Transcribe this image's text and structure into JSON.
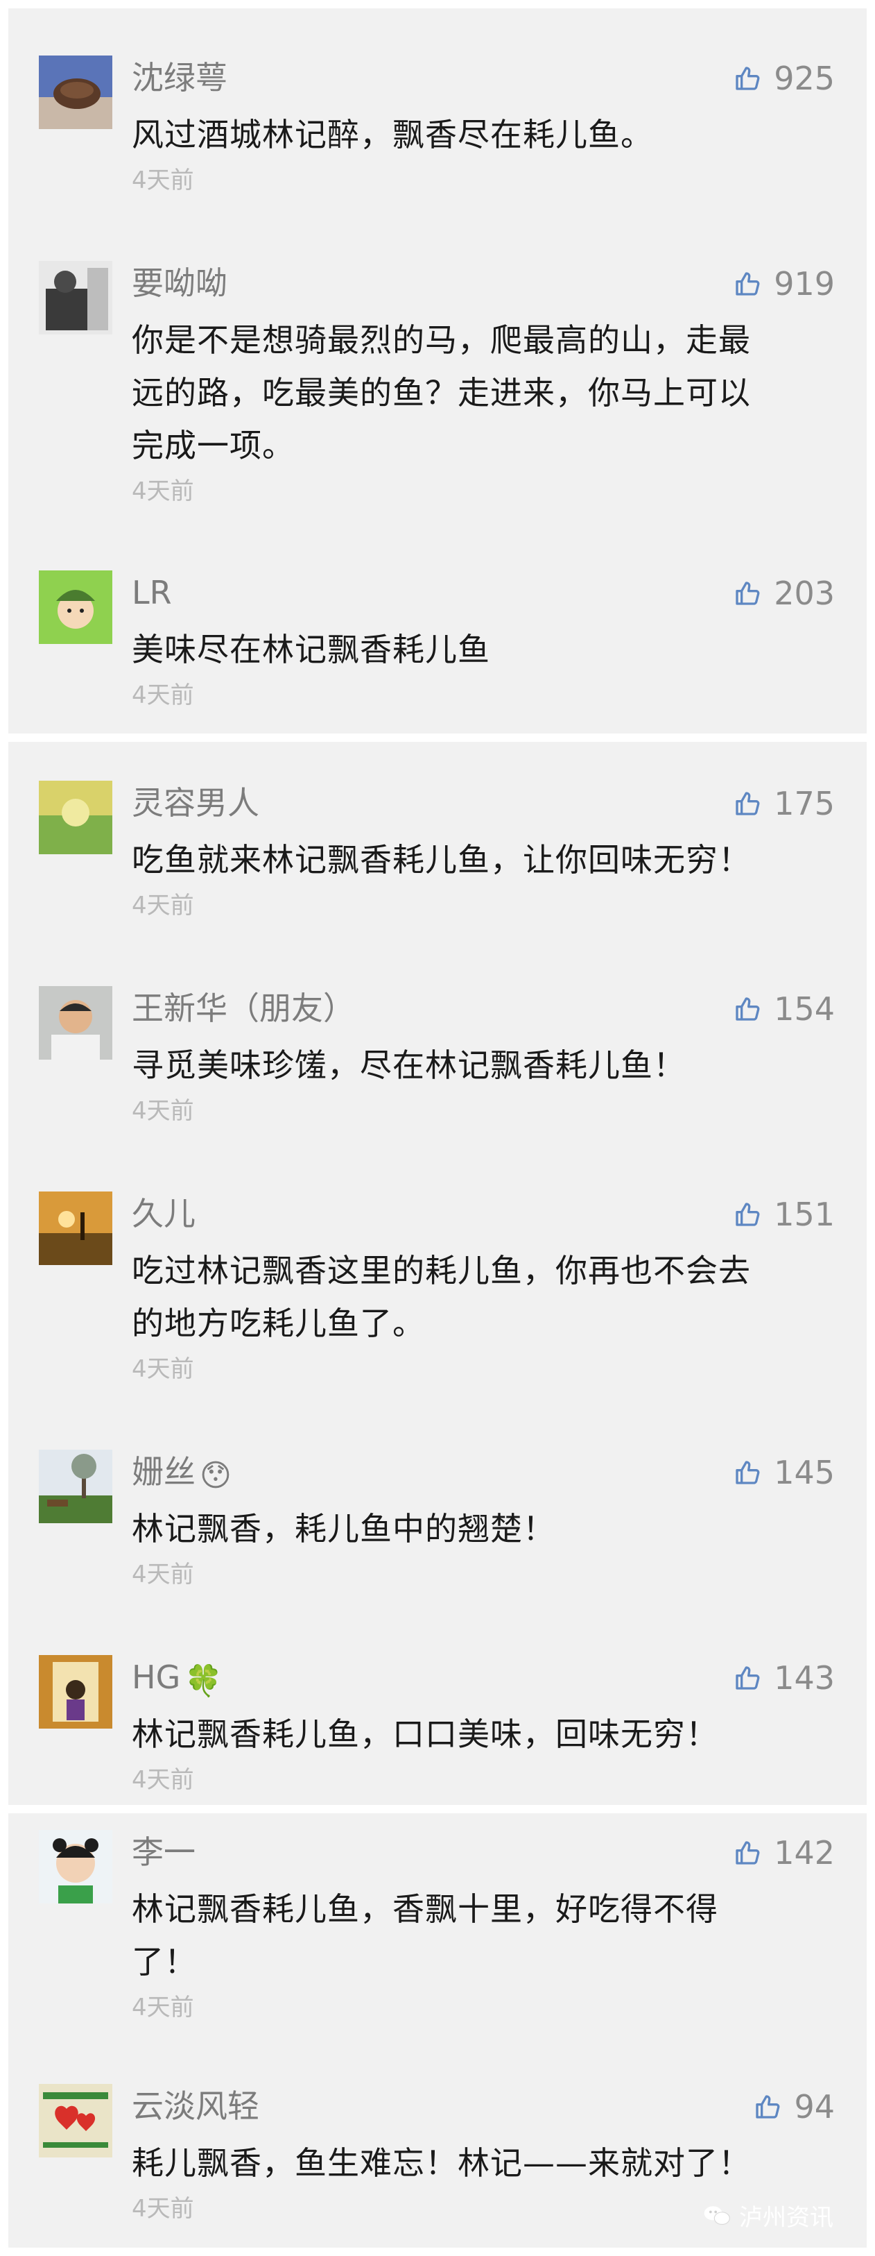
{
  "time_label": "4天前",
  "comments": [
    {
      "name": "沈绿萼",
      "likes": "925",
      "lines": [
        "风过酒城林记醉，飘香尽在耗儿鱼。"
      ],
      "time": "4天前"
    },
    {
      "name": "要呦呦",
      "likes": "919",
      "lines": [
        "你是不是想骑最烈的马，爬最高的山，走最",
        "远的路，吃最美的鱼？走进来，你马上可以",
        "完成一项。"
      ],
      "time": "4天前"
    },
    {
      "name": "LR",
      "likes": "203",
      "lines": [
        "美味尽在林记飘香耗儿鱼"
      ],
      "time": "4天前"
    },
    {
      "name": "灵容男人",
      "likes": "175",
      "lines": [
        "吃鱼就来林记飘香耗儿鱼，让你回味无穷！"
      ],
      "time": "4天前"
    },
    {
      "name": "王新华（朋友）",
      "likes": "154",
      "lines": [
        "寻觅美味珍馐，尽在林记飘香耗儿鱼！"
      ],
      "time": "4天前"
    },
    {
      "name": "久儿",
      "likes": "151",
      "lines": [
        "吃过林记飘香这里的耗儿鱼，你再也不会去",
        "的地方吃耗儿鱼了。"
      ],
      "time": "4天前"
    },
    {
      "name": "姗丝",
      "emoji": "😯",
      "likes": "145",
      "lines": [
        "林记飘香，耗儿鱼中的翘楚！"
      ],
      "time": "4天前"
    },
    {
      "name": "HG",
      "emoji": "🍀",
      "likes": "143",
      "lines": [
        "林记飘香耗儿鱼，口口美味，回味无穷！"
      ],
      "time": "4天前"
    },
    {
      "name": "李一",
      "likes": "142",
      "lines": [
        "林记飘香耗儿鱼，香飘十里，好吃得不得",
        "了！"
      ],
      "time": "4天前"
    },
    {
      "name": "云淡风轻",
      "likes": "94",
      "lines": [
        "耗儿飘香，鱼生难忘！林记——来就对了！"
      ],
      "time": "4天前"
    }
  ],
  "watermark": "泸州资讯"
}
